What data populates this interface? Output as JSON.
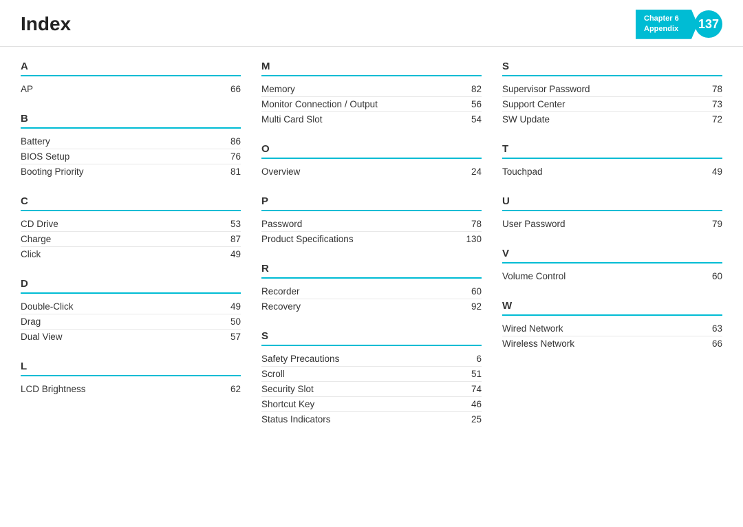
{
  "header": {
    "title": "Index",
    "chapter_label": "Chapter 6",
    "appendix_label": "Appendix",
    "chapter_number": "137"
  },
  "columns": [
    {
      "sections": [
        {
          "letter": "A",
          "items": [
            {
              "term": "AP",
              "page": "66"
            }
          ]
        },
        {
          "letter": "B",
          "items": [
            {
              "term": "Battery",
              "page": "86"
            },
            {
              "term": "BIOS Setup",
              "page": "76"
            },
            {
              "term": "Booting Priority",
              "page": "81"
            }
          ]
        },
        {
          "letter": "C",
          "items": [
            {
              "term": "CD Drive",
              "page": "53"
            },
            {
              "term": "Charge",
              "page": "87"
            },
            {
              "term": "Click",
              "page": "49"
            }
          ]
        },
        {
          "letter": "D",
          "items": [
            {
              "term": "Double-Click",
              "page": "49"
            },
            {
              "term": "Drag",
              "page": "50"
            },
            {
              "term": "Dual View",
              "page": "57"
            }
          ]
        },
        {
          "letter": "L",
          "items": [
            {
              "term": "LCD Brightness",
              "page": "62"
            }
          ]
        }
      ]
    },
    {
      "sections": [
        {
          "letter": "M",
          "items": [
            {
              "term": "Memory",
              "page": "82"
            },
            {
              "term": "Monitor Connection / Output",
              "page": "56"
            },
            {
              "term": "Multi Card Slot",
              "page": "54"
            }
          ]
        },
        {
          "letter": "O",
          "items": [
            {
              "term": "Overview",
              "page": "24"
            }
          ]
        },
        {
          "letter": "P",
          "items": [
            {
              "term": "Password",
              "page": "78"
            },
            {
              "term": "Product Specifications",
              "page": "130"
            }
          ]
        },
        {
          "letter": "R",
          "items": [
            {
              "term": "Recorder",
              "page": "60"
            },
            {
              "term": "Recovery",
              "page": "92"
            }
          ]
        },
        {
          "letter": "S",
          "items": [
            {
              "term": "Safety Precautions",
              "page": "6"
            },
            {
              "term": "Scroll",
              "page": "51"
            },
            {
              "term": "Security Slot",
              "page": "74"
            },
            {
              "term": "Shortcut Key",
              "page": "46"
            },
            {
              "term": "Status Indicators",
              "page": "25"
            }
          ]
        }
      ]
    },
    {
      "sections": [
        {
          "letter": "S",
          "items": [
            {
              "term": "Supervisor Password",
              "page": "78"
            },
            {
              "term": "Support Center",
              "page": "73"
            },
            {
              "term": "SW Update",
              "page": "72"
            }
          ]
        },
        {
          "letter": "T",
          "items": [
            {
              "term": "Touchpad",
              "page": "49"
            }
          ]
        },
        {
          "letter": "U",
          "items": [
            {
              "term": "User Password",
              "page": "79"
            }
          ]
        },
        {
          "letter": "V",
          "items": [
            {
              "term": "Volume Control",
              "page": "60"
            }
          ]
        },
        {
          "letter": "W",
          "items": [
            {
              "term": "Wired Network",
              "page": "63"
            },
            {
              "term": "Wireless Network",
              "page": "66"
            }
          ]
        }
      ]
    }
  ]
}
